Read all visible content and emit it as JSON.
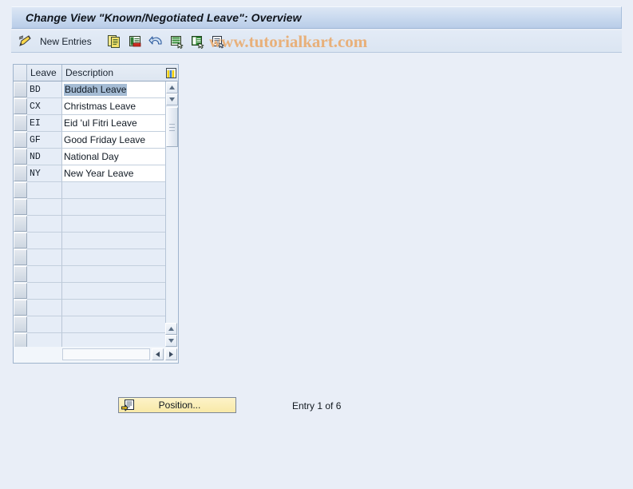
{
  "window": {
    "title": "Change View \"Known/Negotiated Leave\": Overview"
  },
  "toolbar": {
    "edit_icon": "pencil-icon",
    "new_entries_label": "New Entries",
    "buttons": [
      {
        "name": "copy-as-icon",
        "tooltip": "Copy As..."
      },
      {
        "name": "delete-icon",
        "tooltip": "Delete"
      },
      {
        "name": "undo-icon",
        "tooltip": "Undo Change"
      },
      {
        "name": "select-all-icon",
        "tooltip": "Select All"
      },
      {
        "name": "deselect-all-icon",
        "tooltip": "Deselect All"
      },
      {
        "name": "details-icon",
        "tooltip": "Details"
      }
    ]
  },
  "watermark": {
    "text": "www.tutorialkart.com",
    "color": "#e8b07a"
  },
  "table": {
    "select_all_icon": "table-select-all-icon",
    "columns": [
      {
        "key": "leave",
        "label": "Leave"
      },
      {
        "key": "description",
        "label": "Description"
      }
    ],
    "rows": [
      {
        "leave": "BD",
        "description": "Buddah Leave",
        "selected": true
      },
      {
        "leave": "CX",
        "description": "Christmas Leave",
        "selected": false
      },
      {
        "leave": "EI",
        "description": "Eid 'ul Fitri Leave",
        "selected": false
      },
      {
        "leave": "GF",
        "description": "Good Friday Leave",
        "selected": false
      },
      {
        "leave": "ND",
        "description": "National Day",
        "selected": false
      },
      {
        "leave": "NY",
        "description": "New Year Leave",
        "selected": false
      }
    ],
    "empty_row_count": 10,
    "scroll": {
      "up_icon": "scroll-up-icon",
      "down_icon": "scroll-down-icon",
      "thumb_icon": "scroll-thumb-grip-icon",
      "left_icon": "scroll-left-icon",
      "right_icon": "scroll-right-icon"
    }
  },
  "footer": {
    "position_button_label": "Position...",
    "position_button_icon": "position-goto-icon",
    "entry_status": "Entry 1 of 6"
  },
  "colors": {
    "background": "#e9eef7",
    "title_bar": "#cddcf0",
    "selection": "#a5bcd4",
    "button_yellow": "#f8e9a8"
  }
}
